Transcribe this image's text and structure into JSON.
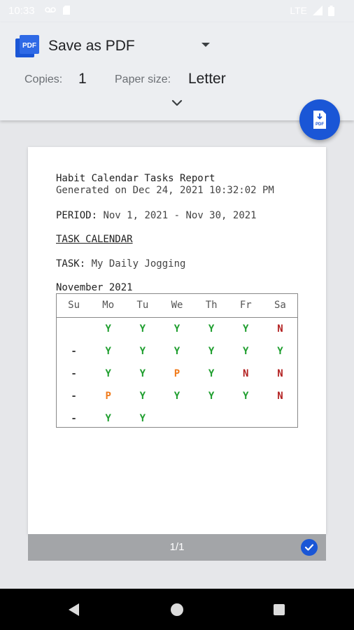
{
  "status_bar": {
    "time": "10:33",
    "network": "LTE"
  },
  "header": {
    "printer_name": "Save as PDF",
    "copies_label": "Copies:",
    "copies_value": "1",
    "paper_size_label": "Paper size:",
    "paper_size_value": "Letter"
  },
  "fab": {
    "icon_label": "PDF"
  },
  "report": {
    "title": "Habit Calendar Tasks Report",
    "generated": "Generated on Dec 24, 2021 10:32:02 PM",
    "period_label": "PERIOD:",
    "period_value": "Nov 1, 2021 - Nov 30, 2021",
    "section_heading": "TASK CALENDAR",
    "task_label": "TASK:",
    "task_value": "My Daily Jogging",
    "month": "November 2021",
    "weekdays": [
      "Su",
      "Mo",
      "Tu",
      "We",
      "Th",
      "Fr",
      "Sa"
    ],
    "weeks": [
      [
        "",
        "Y",
        "Y",
        "Y",
        "Y",
        "Y",
        "N"
      ],
      [
        "-",
        "Y",
        "Y",
        "Y",
        "Y",
        "Y",
        "Y"
      ],
      [
        "-",
        "Y",
        "Y",
        "P",
        "Y",
        "N",
        "N"
      ],
      [
        "-",
        "P",
        "Y",
        "Y",
        "Y",
        "Y",
        "N"
      ],
      [
        "-",
        "Y",
        "Y",
        "",
        "",
        "",
        ""
      ]
    ]
  },
  "colors": {
    "Y": "#1e9e2e",
    "N": "#b32222",
    "P": "#f07a1a",
    "-": "#444444",
    "accent": "#1a56d6"
  },
  "page_indicator": "1/1"
}
